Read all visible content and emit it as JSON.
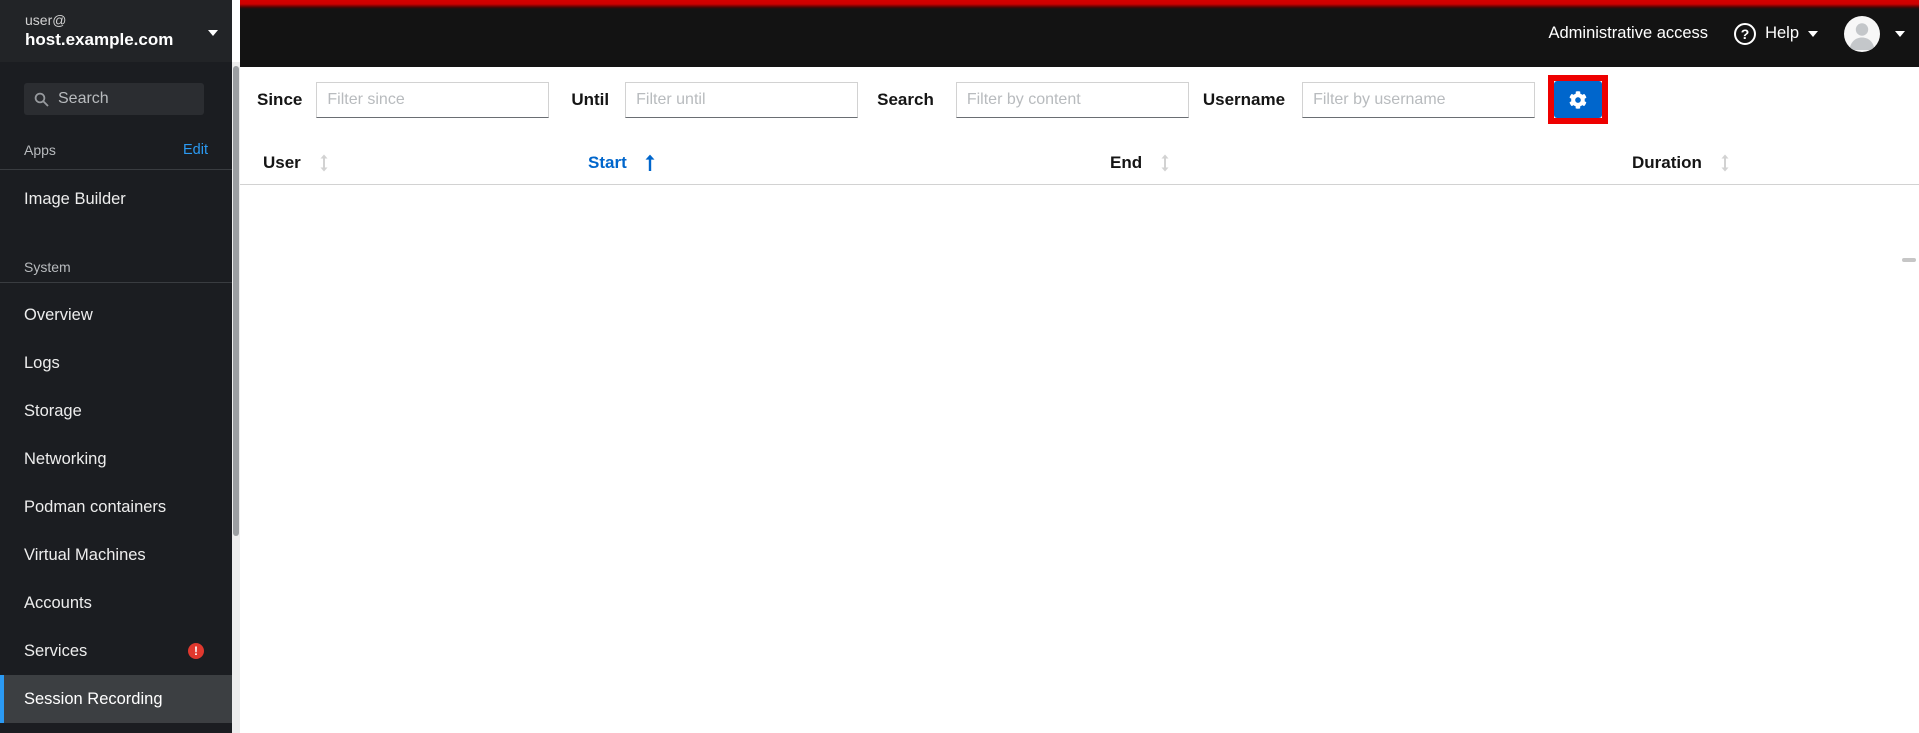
{
  "sidebar": {
    "user": {
      "line1": "user@",
      "line2": "host.example.com"
    },
    "search_placeholder": "Search",
    "apps": {
      "label": "Apps",
      "edit": "Edit",
      "items": [
        {
          "label": "Image Builder"
        }
      ]
    },
    "system": {
      "label": "System",
      "items": [
        {
          "label": "Overview"
        },
        {
          "label": "Logs"
        },
        {
          "label": "Storage"
        },
        {
          "label": "Networking"
        },
        {
          "label": "Podman containers"
        },
        {
          "label": "Virtual Machines"
        },
        {
          "label": "Accounts"
        },
        {
          "label": "Services",
          "badge": "!"
        },
        {
          "label": "Session Recording",
          "selected": true
        }
      ]
    }
  },
  "masthead": {
    "admin_access": "Administrative access",
    "help": "Help",
    "help_icon_glyph": "?"
  },
  "filters": {
    "since": {
      "label": "Since",
      "placeholder": "Filter since"
    },
    "until": {
      "label": "Until",
      "placeholder": "Filter until"
    },
    "search": {
      "label": "Search",
      "placeholder": "Filter by content"
    },
    "username": {
      "label": "Username",
      "placeholder": "Filter by username"
    }
  },
  "table": {
    "columns": [
      {
        "label": "User",
        "sort": "none"
      },
      {
        "label": "Start",
        "sort": "ascending"
      },
      {
        "label": "End",
        "sort": "none"
      },
      {
        "label": "Duration",
        "sort": "none"
      }
    ],
    "rows": []
  },
  "colors": {
    "accent_blue": "#0066cc",
    "link_blue": "#2b9af3",
    "highlight_red": "#ee0000",
    "masthead_red": "#cc0000",
    "badge_red": "#e0382e",
    "sidebar_bg": "#1b1d21",
    "selected_item_bg": "#3c3f42"
  }
}
